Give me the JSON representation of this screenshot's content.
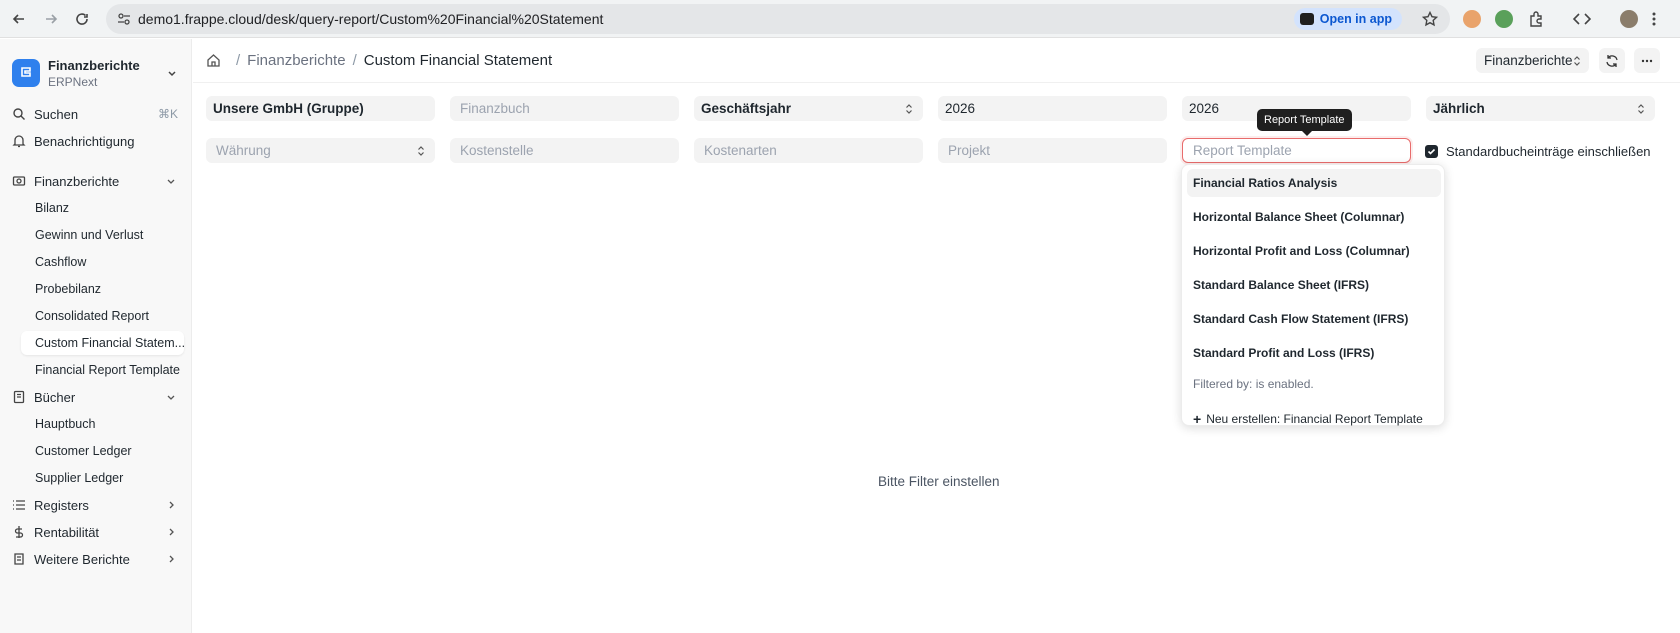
{
  "browser": {
    "url": "demo1.frappe.cloud/desk/query-report/Custom%20Financial%20Statement",
    "open_in_app": "Open in app"
  },
  "sidebar": {
    "brand_title": "Finanzberichte",
    "brand_sub": "ERPNext",
    "search": "Suchen",
    "search_kbd": "⌘K",
    "notifications": "Benachrichtigung",
    "sections": {
      "finanzberichte": "Finanzberichte",
      "buecher": "Bücher",
      "registers": "Registers",
      "rentabilitaet": "Rentabilität",
      "weitere": "Weitere Berichte"
    },
    "reports": [
      "Bilanz",
      "Gewinn und Verlust",
      "Cashflow",
      "Probebilanz",
      "Consolidated Report",
      "Custom Financial Statem...",
      "Financial Report Template"
    ],
    "books": [
      "Hauptbuch",
      "Customer Ledger",
      "Supplier Ledger"
    ]
  },
  "header": {
    "crumb_parent": "Finanzberichte",
    "crumb_current": "Custom Financial Statement",
    "select_value": "Finanzberichte"
  },
  "filters": {
    "company": "Unsere GmbH (Gruppe)",
    "finance_book_ph": "Finanzbuch",
    "period_type": "Geschäftsjahr",
    "from_year": "2026",
    "to_year": "2026",
    "periodicity": "Jährlich",
    "currency_ph": "Währung",
    "cost_center_ph": "Kostenstelle",
    "cost_types_ph": "Kostenarten",
    "project_ph": "Projekt",
    "report_template_ph": "Report Template",
    "include_default_label": "Standardbucheinträge einschließen"
  },
  "tooltip": "Report Template",
  "dropdown": {
    "items": [
      "Financial Ratios Analysis",
      "Horizontal Balance Sheet (Columnar)",
      "Horizontal Profit and Loss (Columnar)",
      "Standard Balance Sheet (IFRS)",
      "Standard Cash Flow Statement (IFRS)",
      "Standard Profit and Loss (IFRS)"
    ],
    "filter_note": "Filtered by: is enabled.",
    "create_new": "Neu erstellen: Financial Report Template"
  },
  "empty_message": "Bitte Filter einstellen"
}
